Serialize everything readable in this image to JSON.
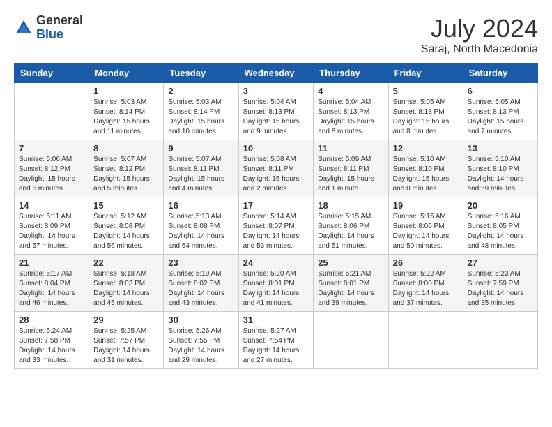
{
  "header": {
    "logo_general": "General",
    "logo_blue": "Blue",
    "month_year": "July 2024",
    "location": "Saraj, North Macedonia"
  },
  "days_of_week": [
    "Sunday",
    "Monday",
    "Tuesday",
    "Wednesday",
    "Thursday",
    "Friday",
    "Saturday"
  ],
  "weeks": [
    [
      {
        "day": "",
        "info": ""
      },
      {
        "day": "1",
        "info": "Sunrise: 5:03 AM\nSunset: 8:14 PM\nDaylight: 15 hours\nand 11 minutes."
      },
      {
        "day": "2",
        "info": "Sunrise: 5:03 AM\nSunset: 8:14 PM\nDaylight: 15 hours\nand 10 minutes."
      },
      {
        "day": "3",
        "info": "Sunrise: 5:04 AM\nSunset: 8:13 PM\nDaylight: 15 hours\nand 9 minutes."
      },
      {
        "day": "4",
        "info": "Sunrise: 5:04 AM\nSunset: 8:13 PM\nDaylight: 15 hours\nand 8 minutes."
      },
      {
        "day": "5",
        "info": "Sunrise: 5:05 AM\nSunset: 8:13 PM\nDaylight: 15 hours\nand 8 minutes."
      },
      {
        "day": "6",
        "info": "Sunrise: 5:05 AM\nSunset: 8:13 PM\nDaylight: 15 hours\nand 7 minutes."
      }
    ],
    [
      {
        "day": "7",
        "info": "Sunrise: 5:06 AM\nSunset: 8:12 PM\nDaylight: 15 hours\nand 6 minutes."
      },
      {
        "day": "8",
        "info": "Sunrise: 5:07 AM\nSunset: 8:12 PM\nDaylight: 15 hours\nand 5 minutes."
      },
      {
        "day": "9",
        "info": "Sunrise: 5:07 AM\nSunset: 8:11 PM\nDaylight: 15 hours\nand 4 minutes."
      },
      {
        "day": "10",
        "info": "Sunrise: 5:08 AM\nSunset: 8:11 PM\nDaylight: 15 hours\nand 2 minutes."
      },
      {
        "day": "11",
        "info": "Sunrise: 5:09 AM\nSunset: 8:11 PM\nDaylight: 15 hours\nand 1 minute."
      },
      {
        "day": "12",
        "info": "Sunrise: 5:10 AM\nSunset: 8:10 PM\nDaylight: 15 hours\nand 0 minutes."
      },
      {
        "day": "13",
        "info": "Sunrise: 5:10 AM\nSunset: 8:10 PM\nDaylight: 14 hours\nand 59 minutes."
      }
    ],
    [
      {
        "day": "14",
        "info": "Sunrise: 5:11 AM\nSunset: 8:09 PM\nDaylight: 14 hours\nand 57 minutes."
      },
      {
        "day": "15",
        "info": "Sunrise: 5:12 AM\nSunset: 8:08 PM\nDaylight: 14 hours\nand 56 minutes."
      },
      {
        "day": "16",
        "info": "Sunrise: 5:13 AM\nSunset: 8:08 PM\nDaylight: 14 hours\nand 54 minutes."
      },
      {
        "day": "17",
        "info": "Sunrise: 5:14 AM\nSunset: 8:07 PM\nDaylight: 14 hours\nand 53 minutes."
      },
      {
        "day": "18",
        "info": "Sunrise: 5:15 AM\nSunset: 8:06 PM\nDaylight: 14 hours\nand 51 minutes."
      },
      {
        "day": "19",
        "info": "Sunrise: 5:15 AM\nSunset: 8:06 PM\nDaylight: 14 hours\nand 50 minutes."
      },
      {
        "day": "20",
        "info": "Sunrise: 5:16 AM\nSunset: 8:05 PM\nDaylight: 14 hours\nand 48 minutes."
      }
    ],
    [
      {
        "day": "21",
        "info": "Sunrise: 5:17 AM\nSunset: 8:04 PM\nDaylight: 14 hours\nand 46 minutes."
      },
      {
        "day": "22",
        "info": "Sunrise: 5:18 AM\nSunset: 8:03 PM\nDaylight: 14 hours\nand 45 minutes."
      },
      {
        "day": "23",
        "info": "Sunrise: 5:19 AM\nSunset: 8:02 PM\nDaylight: 14 hours\nand 43 minutes."
      },
      {
        "day": "24",
        "info": "Sunrise: 5:20 AM\nSunset: 8:01 PM\nDaylight: 14 hours\nand 41 minutes."
      },
      {
        "day": "25",
        "info": "Sunrise: 5:21 AM\nSunset: 8:01 PM\nDaylight: 14 hours\nand 39 minutes."
      },
      {
        "day": "26",
        "info": "Sunrise: 5:22 AM\nSunset: 8:00 PM\nDaylight: 14 hours\nand 37 minutes."
      },
      {
        "day": "27",
        "info": "Sunrise: 5:23 AM\nSunset: 7:59 PM\nDaylight: 14 hours\nand 35 minutes."
      }
    ],
    [
      {
        "day": "28",
        "info": "Sunrise: 5:24 AM\nSunset: 7:58 PM\nDaylight: 14 hours\nand 33 minutes."
      },
      {
        "day": "29",
        "info": "Sunrise: 5:25 AM\nSunset: 7:57 PM\nDaylight: 14 hours\nand 31 minutes."
      },
      {
        "day": "30",
        "info": "Sunrise: 5:26 AM\nSunset: 7:55 PM\nDaylight: 14 hours\nand 29 minutes."
      },
      {
        "day": "31",
        "info": "Sunrise: 5:27 AM\nSunset: 7:54 PM\nDaylight: 14 hours\nand 27 minutes."
      },
      {
        "day": "",
        "info": ""
      },
      {
        "day": "",
        "info": ""
      },
      {
        "day": "",
        "info": ""
      }
    ]
  ]
}
